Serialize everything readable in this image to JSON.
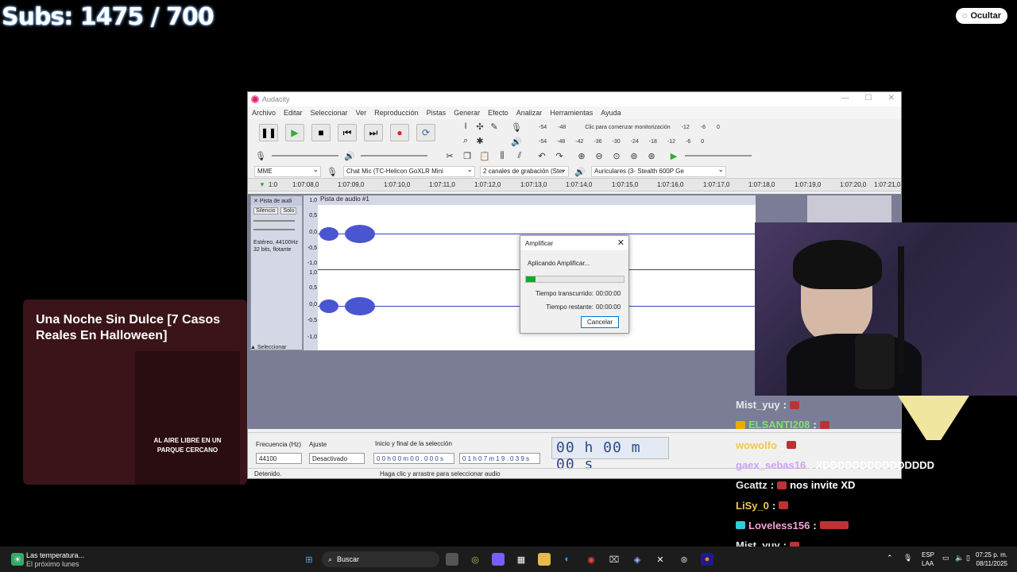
{
  "overlay": {
    "subs": "Subs: 1475 / 700",
    "ocultar": "Ocultar"
  },
  "audacity": {
    "title": "Audacity",
    "menu": [
      "Archivo",
      "Editar",
      "Seleccionar",
      "Ver",
      "Reproducción",
      "Pistas",
      "Generar",
      "Efecto",
      "Analizar",
      "Herramientas",
      "Ayuda"
    ],
    "meter_hint": "Clic para comenzar monitorización",
    "meter_ticks_top": [
      "-54",
      "-48",
      "-12",
      "-6",
      "0"
    ],
    "meter_ticks_bottom": [
      "-54",
      "-48",
      "-42",
      "-36",
      "-30",
      "-24",
      "-18",
      "-12",
      "-6",
      "0"
    ],
    "host": "MME",
    "mic": "Chat Mic (TC-Helicon GoXLR Mini",
    "channels": "2 canales de grabación (Ster",
    "output": "Auriculares (3- Stealth 600P Ge",
    "timeline": [
      "1:0",
      "1:07:08,0",
      "1:07:09,0",
      "1:07:10,0",
      "1:07:11,0",
      "1:07:12,0",
      "1:07:13,0",
      "1:07:14,0",
      "1:07:15,0",
      "1:07:16,0",
      "1:07:17,0",
      "1:07:18,0",
      "1:07:19,0",
      "1:07:20,0",
      "1:07:21,0"
    ],
    "track": {
      "name": "Pista de audi",
      "full_name": "Pista de audio #1",
      "silence": "Silencio",
      "solo": "Solo",
      "info1": "Estéreo, 44100Hz",
      "info2": "32 bits, flotante",
      "select": "Seleccionar",
      "scale": [
        "1,0",
        "0,5",
        "0,0",
        "-0,5",
        "-1,0"
      ]
    },
    "bottom": {
      "freq_label": "Frecuencia (Hz)",
      "freq_value": "44100",
      "snap_label": "Ajuste",
      "snap_value": "Desactivado",
      "sel_label": "Inicio y final de la selección",
      "sel_start": "0 0 h 0 0 m 0 0 . 0 0 0 s",
      "sel_end": "0 1 h 0 7 m 1 9 . 0 3 9 s",
      "big_time": "00 h 00 m 00 s",
      "status": "Detenido.",
      "hint": "Haga clic y arrastre para seleccionar audio"
    }
  },
  "dialog": {
    "title": "Amplificar",
    "message": "Aplicando Amplificar...",
    "elapsed_label": "Tiempo transcurrido:",
    "elapsed_value": "00:00:00",
    "remaining_label": "Tiempo restante:",
    "remaining_value": "00:00:00",
    "cancel": "Cancelar",
    "progress": 0.1
  },
  "video": {
    "title": "Una Noche Sin Dulce [7 Casos Reales En Halloween]",
    "caption_line1": "AL AIRE LIBRE EN UN",
    "caption_line2": "PARQUE CERCANO"
  },
  "chat": [
    {
      "user": "Mist_yuy",
      "color": "#e8e8e8",
      "msg": ""
    },
    {
      "user": "ELSANTI208",
      "color": "#7fe36a",
      "msg": ""
    },
    {
      "user": "wowolfo",
      "color": "#f2c94c",
      "msg": ""
    },
    {
      "user": "gaex_sebas16",
      "color": "#c9a3f5",
      "msg": "XDDDDDDDDDDDDDDD"
    },
    {
      "user": "Gcattz",
      "color": "#e8e8e8",
      "msg": "nos invite XD"
    },
    {
      "user": "LiSy_0",
      "color": "#f2c94c",
      "msg": ""
    },
    {
      "user": "Loveless156",
      "color": "#f5a3d3",
      "msg": ""
    },
    {
      "user": "Mist_yuy",
      "color": "#e8e8e8",
      "msg": ""
    }
  ],
  "taskbar": {
    "weather_line1": "Las temperatura...",
    "weather_line2": "El próximo lunes",
    "search": "Buscar",
    "lang1": "ESP",
    "lang2": "LAA",
    "time": "07:25 p. m.",
    "date": "08/11/2025"
  }
}
